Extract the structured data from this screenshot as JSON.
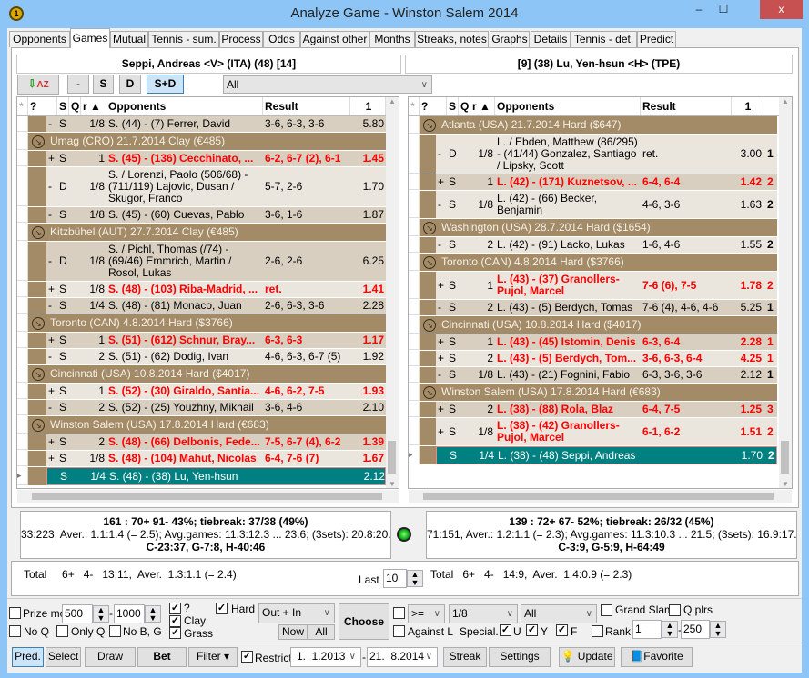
{
  "window": {
    "title": "Analyze Game - Winston Salem 2014",
    "minimize": "‒",
    "maximize": "☐",
    "close": "x",
    "app_icon": "tennis-ball-icon"
  },
  "tabs": [
    "Opponents",
    "Games",
    "Mutual",
    "Tennis - sum.",
    "Process",
    "Odds",
    "Against other",
    "Months",
    "Streaks, notes",
    "Graphs",
    "Details",
    "Tennis - det.",
    "Predict"
  ],
  "active_tab": "Games",
  "left_player": "Seppi, Andreas <V> (ITA) (48) [14]",
  "right_player": "[9] (38) Lu, Yen-hsun <H> (TPE)",
  "toolbar": {
    "sort_icon": "sort-az-icon",
    "minus": "-",
    "s": "S",
    "d": "D",
    "sd": "S+D",
    "filter_value": "All",
    "active": "S+D"
  },
  "columns": {
    "star": "*",
    "q": "?",
    "s": "S",
    "qq": "Q",
    "r": "r ▲",
    "opp": "Opponents",
    "res": "Result",
    "odds": "1"
  },
  "left_rows": [
    {
      "k": "m",
      "pm": "-",
      "t": "S",
      "r": "1/8",
      "opp": "S. (44) - (7) Ferrer, David",
      "res": "3-6, 6-3, 3-6",
      "odds": "5.80"
    },
    {
      "k": "g",
      "name": "Umag (CRO) 21.7.2014  Clay  (€485)"
    },
    {
      "k": "m",
      "pm": "+",
      "t": "S",
      "r": "1",
      "opp": "S. (45) - (136) Cecchinato, ...",
      "res": "6-2, 6-7 (2), 6-1",
      "odds": "1.45",
      "w": true
    },
    {
      "k": "m",
      "pm": "-",
      "t": "D",
      "r": "1/8",
      "opp": "S. / Lorenzi, Paolo (506/68) - (711/119) Lajovic, Dusan / Skugor, Franco",
      "res": "5-7, 2-6",
      "odds": "1.70"
    },
    {
      "k": "m",
      "pm": "-",
      "t": "S",
      "r": "1/8",
      "opp": "S. (45) - (60) Cuevas, Pablo",
      "res": "3-6, 1-6",
      "odds": "1.87"
    },
    {
      "k": "g",
      "name": "Kitzbühel (AUT) 27.7.2014  Clay  (€485)"
    },
    {
      "k": "m",
      "pm": "-",
      "t": "D",
      "r": "1/8",
      "opp": "S. / Pichl, Thomas (/74) - (69/46) Emmrich, Martin / Rosol, Lukas",
      "res": "2-6, 2-6",
      "odds": "6.25"
    },
    {
      "k": "m",
      "pm": "+",
      "t": "S",
      "r": "1/8",
      "opp": "S. (48) - (103) Riba-Madrid, ...",
      "res": "ret.",
      "odds": "1.41",
      "w": true
    },
    {
      "k": "m",
      "pm": "-",
      "t": "S",
      "r": "1/4",
      "opp": "S. (48) - (81) Monaco, Juan",
      "res": "2-6, 6-3, 3-6",
      "odds": "2.28"
    },
    {
      "k": "g",
      "name": "Toronto (CAN) 4.8.2014  Hard  ($3766)"
    },
    {
      "k": "m",
      "pm": "+",
      "t": "S",
      "r": "1",
      "opp": "S. (51) - (612) Schnur, Bray...",
      "res": "6-3, 6-3",
      "odds": "1.17",
      "w": true
    },
    {
      "k": "m",
      "pm": "-",
      "t": "S",
      "r": "2",
      "opp": "S. (51) - (62) Dodig, Ivan",
      "res": "4-6, 6-3, 6-7 (5)",
      "odds": "1.92"
    },
    {
      "k": "g",
      "name": "Cincinnati (USA) 10.8.2014  Hard  ($4017)"
    },
    {
      "k": "m",
      "pm": "+",
      "t": "S",
      "r": "1",
      "opp": "S. (52) - (30) Giraldo, Santia...",
      "res": "4-6, 6-2, 7-5",
      "odds": "1.93",
      "w": true
    },
    {
      "k": "m",
      "pm": "-",
      "t": "S",
      "r": "2",
      "opp": "S. (52) - (25) Youzhny, Mikhail",
      "res": "3-6, 4-6",
      "odds": "2.10"
    },
    {
      "k": "g",
      "name": "Winston Salem (USA) 17.8.2014  Hard  (€683)"
    },
    {
      "k": "m",
      "pm": "+",
      "t": "S",
      "r": "2",
      "opp": "S. (48) - (66) Delbonis, Fede...",
      "res": "7-5, 6-7 (4), 6-2",
      "odds": "1.39",
      "w": true
    },
    {
      "k": "m",
      "pm": "+",
      "t": "S",
      "r": "1/8",
      "opp": "S. (48) - (104) Mahut, Nicolas",
      "res": "6-4, 7-6 (7)",
      "odds": "1.67",
      "w": true
    },
    {
      "k": "m",
      "pm": "",
      "t": "S",
      "r": "1/4",
      "opp": "S. (48) - (38) Lu, Yen-hsun",
      "res": "",
      "odds": "2.12",
      "sel": true
    }
  ],
  "right_rows": [
    {
      "k": "g",
      "name": "Atlanta (USA) 21.7.2014  Hard  ($647)"
    },
    {
      "k": "m",
      "pm": "-",
      "t": "D",
      "r": "1/8",
      "opp": "L. / Ebden, Matthew (86/295) - (41/44) Gonzalez, Santiago / Lipsky, Scott",
      "res": "ret.",
      "odds": "3.00",
      "x": "1"
    },
    {
      "k": "m",
      "pm": "+",
      "t": "S",
      "r": "1",
      "opp": "L. (42) - (171) Kuznetsov, ...",
      "res": "6-4, 6-4",
      "odds": "1.42",
      "x": "2",
      "w": true
    },
    {
      "k": "m",
      "pm": "-",
      "t": "S",
      "r": "1/8",
      "opp": "L. (42) - (66) Becker, Benjamin",
      "res": "4-6, 3-6",
      "odds": "1.63",
      "x": "2"
    },
    {
      "k": "g",
      "name": "Washington (USA) 28.7.2014  Hard  ($1654)"
    },
    {
      "k": "m",
      "pm": "-",
      "t": "S",
      "r": "2",
      "opp": "L. (42) - (91) Lacko, Lukas",
      "res": "1-6, 4-6",
      "odds": "1.55",
      "x": "2"
    },
    {
      "k": "g",
      "name": "Toronto (CAN) 4.8.2014  Hard  ($3766)"
    },
    {
      "k": "m",
      "pm": "+",
      "t": "S",
      "r": "1",
      "opp": "L. (43) - (37) Granollers-Pujol, Marcel",
      "res": "7-6 (6), 7-5",
      "odds": "1.78",
      "x": "2",
      "w": true
    },
    {
      "k": "m",
      "pm": "-",
      "t": "S",
      "r": "2",
      "opp": "L. (43) - (5) Berdych, Tomas",
      "res": "7-6 (4), 4-6, 4-6",
      "odds": "5.25",
      "x": "1"
    },
    {
      "k": "g",
      "name": "Cincinnati (USA) 10.8.2014  Hard  ($4017)"
    },
    {
      "k": "m",
      "pm": "+",
      "t": "S",
      "r": "1",
      "opp": "L. (43) - (45) Istomin, Denis",
      "res": "6-3, 6-4",
      "odds": "2.28",
      "x": "1",
      "w": true
    },
    {
      "k": "m",
      "pm": "+",
      "t": "S",
      "r": "2",
      "opp": "L. (43) - (5) Berdych, Tom...",
      "res": "3-6, 6-3, 6-4",
      "odds": "4.25",
      "x": "1",
      "w": true
    },
    {
      "k": "m",
      "pm": "-",
      "t": "S",
      "r": "1/8",
      "opp": "L. (43) - (21) Fognini, Fabio",
      "res": "6-3, 3-6, 3-6",
      "odds": "2.12",
      "x": "1"
    },
    {
      "k": "g",
      "name": "Winston Salem (USA) 17.8.2014  Hard  (€683)"
    },
    {
      "k": "m",
      "pm": "+",
      "t": "S",
      "r": "2",
      "opp": "L. (38) - (88) Rola, Blaz",
      "res": "6-4, 7-5",
      "odds": "1.25",
      "x": "3",
      "w": true
    },
    {
      "k": "m",
      "pm": "+",
      "t": "S",
      "r": "1/8",
      "opp": "L. (38) - (42) Granollers-Pujol, Marcel",
      "res": "6-1, 6-2",
      "odds": "1.51",
      "x": "2",
      "w": true
    },
    {
      "k": "m",
      "pm": "",
      "t": "S",
      "r": "1/4",
      "opp": "L. (38) - (48) Seppi, Andreas",
      "res": "",
      "odds": "1.70",
      "x": "2",
      "sel": true
    }
  ],
  "stats_left": {
    "l1": "161 : 70+  91-  43%; tiebreak: 37/38 (49%)",
    "l2": "33:223, Aver.: 1.1:1.4 (= 2.5);  Avg.games: 11.3:12.3 ... 23.6;  (3sets): 20.8:20.0",
    "l3": "C-23:37, G-7:8, H-40:46"
  },
  "stats_right": {
    "l1": "139 : 72+  67-  52%; tiebreak: 26/32 (45%)",
    "l2": "71:151, Aver.: 1.2:1.1 (= 2.3);  Avg.games: 11.3:10.3 ... 21.5;  (3sets): 16.9:17.6",
    "l3": "C-3:9, G-5:9, H-64:49"
  },
  "indicator_color": "#22CC22",
  "total_left": "Total     6+   4-   13:11,  Aver.  1.3:1.1 (= 2.4)",
  "total_right": "Total   6+   4-   14:9,  Aver.  1.4:0.9 (= 2.3)",
  "last_label": "Last",
  "last_value": "10",
  "filters": {
    "prize_label": "Prize mor",
    "prize_from": "500",
    "prize_to": "1000",
    "dash": "-",
    "q_label": "?",
    "clay": "Clay",
    "grass": "Grass",
    "hard": "Hard",
    "inout": "Out + In",
    "now": "Now",
    "all": "All",
    "choose": "Choose",
    "no_q": "No Q",
    "only_q": "Only Q",
    "no_bg": "No B, G",
    "cmp": ">=",
    "round": "1/8",
    "type": "All",
    "grand_slam": "Grand Slam",
    "q_plrs": "Q plrs",
    "against_l": "Against L",
    "special": "Special.",
    "u": "U",
    "y": "Y",
    "f": "F",
    "rank": "Rank.",
    "rank_from": "1",
    "rank_to": "250"
  },
  "bottom": {
    "pred": "Pred.",
    "select": "Select",
    "draw": "Draw",
    "bet": "Bet",
    "filter": "Filter ▾",
    "restrict": "Restrict",
    "date_from": "1.  1.2013",
    "date_to": "21.  8.2014",
    "streak": "Streak",
    "settings": "Settings",
    "update": "Update",
    "favorite": "Favorite"
  },
  "colors": {
    "group": "#A38B67",
    "selected": "#008080",
    "win": "#FF0000",
    "row_a": "#EAE5DD",
    "row_b": "#D8CFC1"
  }
}
